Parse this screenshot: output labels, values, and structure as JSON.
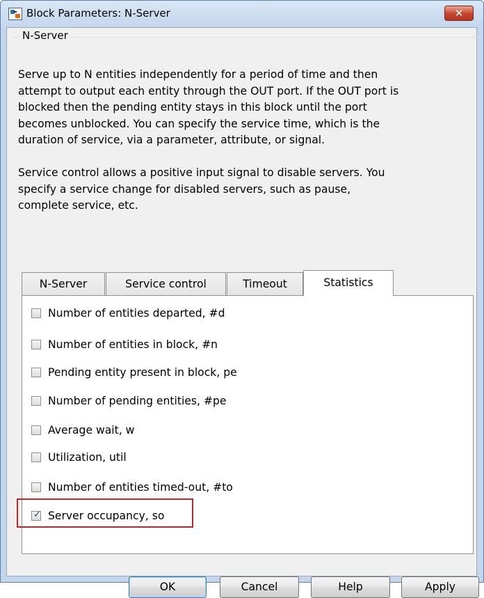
{
  "window": {
    "title": "Block Parameters: N-Server"
  },
  "group": {
    "label": "N-Server",
    "description_1": "Serve up to N entities independently for a period of time and then\nattempt to output each entity through the OUT port. If the OUT port is\nblocked then the pending entity stays in this block until the port\nbecomes unblocked. You can specify the service time, which is the\nduration of service, via a parameter, attribute, or signal.",
    "description_2": "Service control allows a positive input signal to disable servers. You\nspecify a service change for disabled servers, such as pause,\ncomplete service, etc."
  },
  "tabs": [
    {
      "label": "N-Server",
      "active": false
    },
    {
      "label": "Service control",
      "active": false
    },
    {
      "label": "Timeout",
      "active": false
    },
    {
      "label": "Statistics",
      "active": true
    }
  ],
  "statistics": [
    {
      "label": "Number of entities departed, #d",
      "checked": false
    },
    {
      "label": "Number of entities in block, #n",
      "checked": false
    },
    {
      "label": "Pending entity present in block, pe",
      "checked": false
    },
    {
      "label": "Number of pending entities, #pe",
      "checked": false
    },
    {
      "label": "Average wait, w",
      "checked": false
    },
    {
      "label": "Utilization, util",
      "checked": false
    },
    {
      "label": "Number of entities timed-out, #to",
      "checked": false
    },
    {
      "label": "Server occupancy, so",
      "checked": true
    }
  ],
  "buttons": {
    "ok": "OK",
    "cancel": "Cancel",
    "help": "Help",
    "apply": "Apply"
  },
  "colors": {
    "title_bar": "#c4d7ed",
    "close_button": "#c7442e",
    "highlight_border": "#b22a2a",
    "checkmark": "#1d3c82"
  }
}
